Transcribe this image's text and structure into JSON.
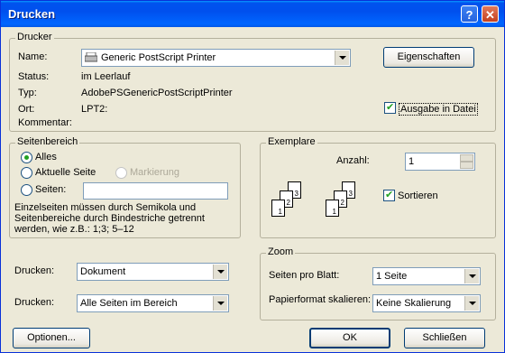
{
  "window": {
    "title": "Drucken"
  },
  "printer": {
    "legend": "Drucker",
    "name_label": "Name:",
    "name_value": "Generic PostScript Printer",
    "properties_button": "Eigenschaften",
    "status_label": "Status:",
    "status_value": "im Leerlauf",
    "type_label": "Typ:",
    "type_value": "AdobePSGenericPostScriptPrinter",
    "location_label": "Ort:",
    "location_value": "LPT2:",
    "comment_label": "Kommentar:",
    "print_to_file_label": "Ausgabe in Datei",
    "print_to_file_checked": true
  },
  "page_range": {
    "legend": "Seitenbereich",
    "all_label": "Alles",
    "current_label": "Aktuelle Seite",
    "selection_label": "Markierung",
    "pages_label": "Seiten:",
    "pages_value": "",
    "selected": "all",
    "hint": "Einzelseiten müssen durch Semikola und Seitenbereiche durch Bindestriche getrennt werden, wie z.B.: 1;3; 5–12"
  },
  "copies": {
    "legend": "Exemplare",
    "count_label": "Anzahl:",
    "count_value": "1",
    "collate_label": "Sortieren",
    "collate_checked": true,
    "pages_stack": [
      "3",
      "2",
      "1"
    ]
  },
  "print_what": {
    "label": "Drucken:",
    "value": "Dokument"
  },
  "print_range": {
    "label": "Drucken:",
    "value": "Alle Seiten im Bereich"
  },
  "zoom": {
    "legend": "Zoom",
    "pages_per_sheet_label": "Seiten pro Blatt:",
    "pages_per_sheet_value": "1 Seite",
    "scale_label": "Papierformat skalieren:",
    "scale_value": "Keine Skalierung"
  },
  "buttons": {
    "options": "Optionen...",
    "ok": "OK",
    "close": "Schließen"
  }
}
